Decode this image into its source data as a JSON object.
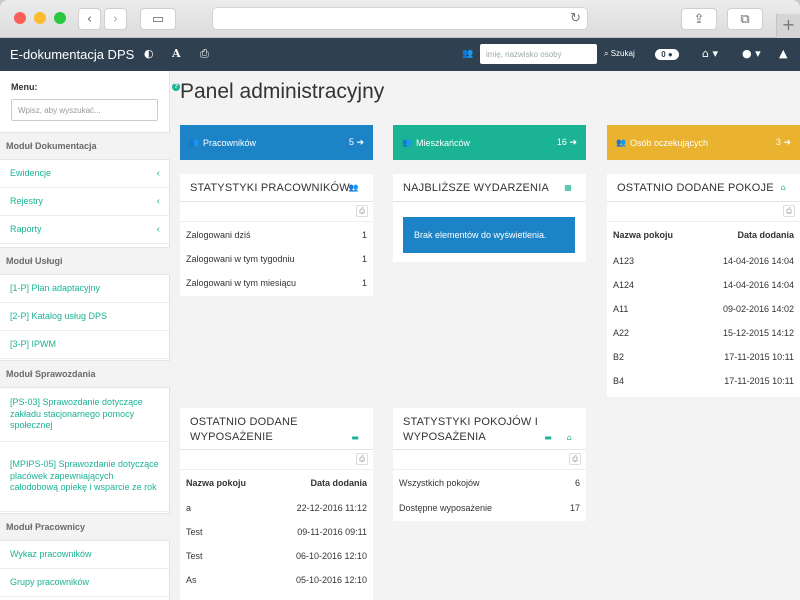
{
  "app": {
    "title": "E-dokumentacja DPS"
  },
  "nav": {
    "search_placeholder": "imię, nazwisko osoby",
    "search_button": "Szukaj",
    "notifications_count": "0"
  },
  "sidebar": {
    "menu_label": "Menu:",
    "search_placeholder": "Wpisz, aby wyszukać...",
    "sections": [
      {
        "title": "Moduł Dokumentacja",
        "items": [
          "Ewidencje",
          "Rejestry",
          "Raporty"
        ]
      },
      {
        "title": "Moduł Usługi",
        "items": [
          "[1-P] Plan adaptacyjny",
          "[2-P] Katalog usług DPS",
          "[3-P] IPWM"
        ]
      },
      {
        "title": "Moduł Sprawozdania",
        "items": [
          "[PS-03] Sprawozdanie dotyczące zakładu stacjonarnego pomocy społecznej",
          "[MPIPS-05] Sprawozdanie dotyczące placówek zapewniających całodobową opiekę i wsparcie ze rok"
        ]
      },
      {
        "title": "Moduł Pracownicy",
        "items": [
          "Wykaz pracowników",
          "Grupy pracowników"
        ]
      }
    ]
  },
  "page": {
    "title": "Panel administracyjny"
  },
  "stats": [
    {
      "label": "Pracowników",
      "count": "5",
      "color": "#1c84c6"
    },
    {
      "label": "Mieszkańców",
      "count": "16",
      "color": "#1ab394"
    },
    {
      "label": "Osób oczekujących",
      "count": "3",
      "color": "#e9b22f"
    }
  ],
  "panels": {
    "staff_stats": {
      "title": "Statystyki pracowników",
      "rows": [
        {
          "label": "Zalogowani dziś",
          "value": "1"
        },
        {
          "label": "Zalogowani w tym tygodniu",
          "value": "1"
        },
        {
          "label": "Zalogowani w tym miesiącu",
          "value": "1"
        }
      ]
    },
    "events": {
      "title": "Najbliższe wydarzenia",
      "empty": "Brak elementów do wyświetlenia."
    },
    "rooms": {
      "title": "Ostatnio dodane pokoje",
      "col1": "Nazwa pokoju",
      "col2": "Data dodania",
      "rows": [
        {
          "name": "A123",
          "date": "14-04-2016 14:04"
        },
        {
          "name": "A124",
          "date": "14-04-2016 14:04"
        },
        {
          "name": "A11",
          "date": "09-02-2016 14:02"
        },
        {
          "name": "A22",
          "date": "15-12-2015 14:12"
        },
        {
          "name": "B2",
          "date": "17-11-2015 10:11"
        },
        {
          "name": "B4",
          "date": "17-11-2015 10:11"
        }
      ]
    },
    "equipment": {
      "title_line1": "Ostatnio dodane",
      "title_line2": "wyposażenie",
      "col1": "Nazwa pokoju",
      "col2": "Data dodania",
      "rows": [
        {
          "name": "a",
          "date": "22-12-2016 11:12"
        },
        {
          "name": "Test",
          "date": "09-11-2016 09:11"
        },
        {
          "name": "Test",
          "date": "06-10-2016 12:10"
        },
        {
          "name": "As",
          "date": "05-10-2016 12:10"
        }
      ]
    },
    "room_stats": {
      "title_line1": "Statystyki pokojów i",
      "title_line2": "wyposażenia",
      "rows": [
        {
          "label": "Wszystkich pokojów",
          "value": "6"
        },
        {
          "label": "Dostępne wyposażenie",
          "value": "17"
        }
      ]
    }
  }
}
